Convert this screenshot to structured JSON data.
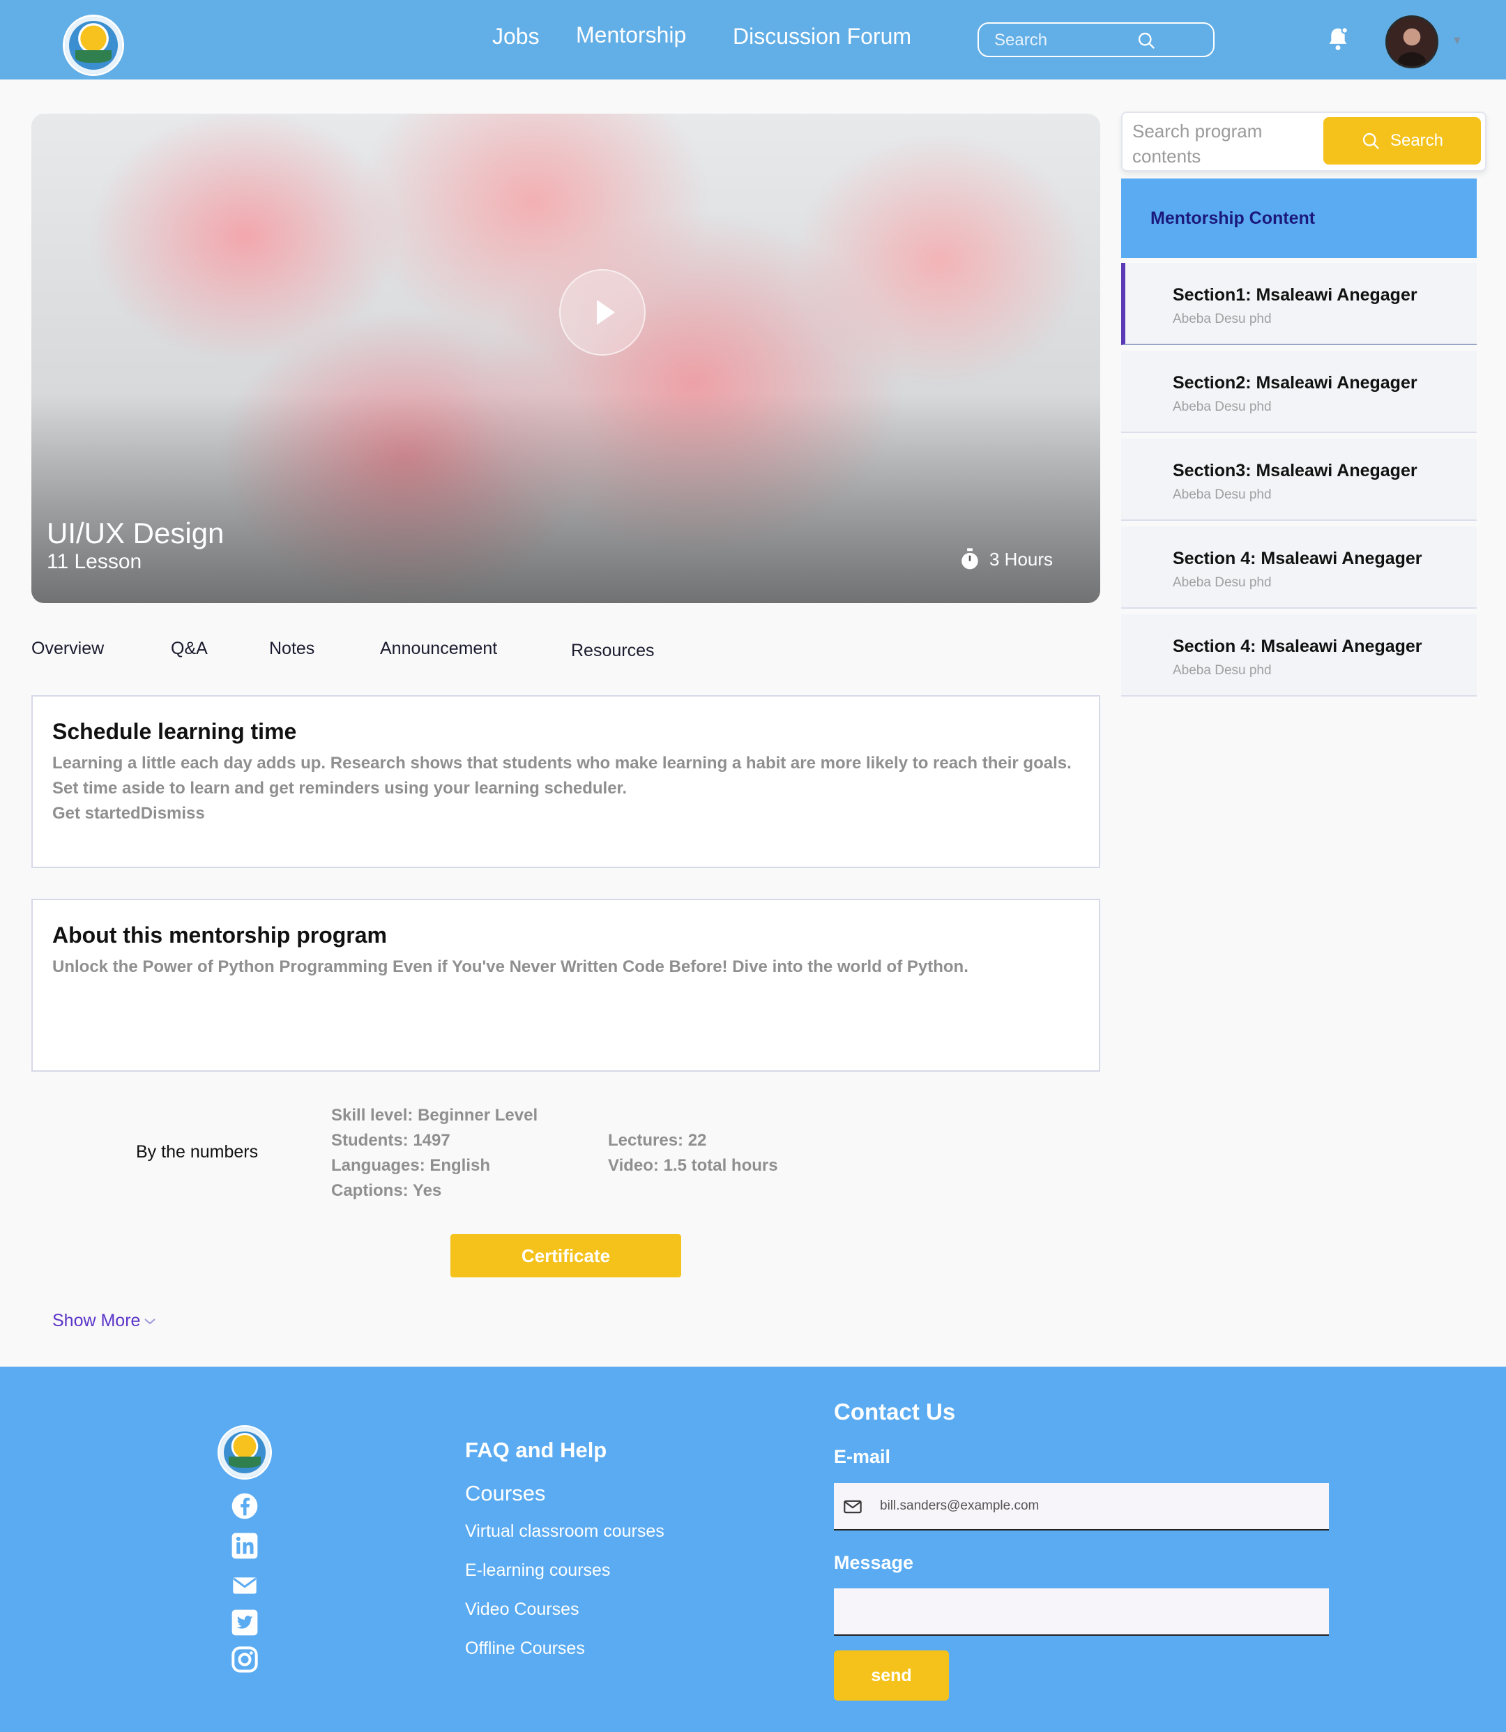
{
  "header": {
    "nav": [
      "Jobs",
      "Mentorship",
      "Discussion Forum"
    ],
    "search_placeholder": "Search"
  },
  "hero": {
    "title": "UI/UX Design",
    "lessons": "11 Lesson",
    "duration": "3 Hours"
  },
  "tabs": [
    "Overview",
    "Q&A",
    "Notes",
    "Announcement",
    "Resources"
  ],
  "schedule": {
    "title": "Schedule learning time",
    "body": "Learning a little each day adds up. Research shows that students who make learning a habit are more likely to reach their goals. Set time aside to learn and get reminders using your learning scheduler.",
    "actions": "Get startedDismiss"
  },
  "about": {
    "title": "About this mentorship program",
    "body": "Unlock the Power of Python Programming Even if You've Never Written Code Before! Dive into the world of Python."
  },
  "numbers": {
    "label": "By the numbers",
    "col1": [
      "Skill level: Beginner Level",
      "Students: 1497",
      "Languages: English",
      "Captions: Yes"
    ],
    "col2": [
      "Lectures: 22",
      "Video: 1.5 total hours"
    ]
  },
  "certificate_label": "Certificate",
  "show_more_label": "Show More",
  "sidebar": {
    "search_placeholder": "Search program contents",
    "search_button": "Search",
    "content_title": "Mentorship Content",
    "sections": [
      {
        "title": "Section1: Msaleawi Anegager",
        "author": "Abeba Desu phd"
      },
      {
        "title": "Section2: Msaleawi Anegager",
        "author": "Abeba Desu phd"
      },
      {
        "title": "Section3: Msaleawi Anegager",
        "author": "Abeba Desu phd"
      },
      {
        "title": "Section 4: Msaleawi Anegager",
        "author": "Abeba Desu phd"
      },
      {
        "title": "Section 4: Msaleawi Anegager",
        "author": "Abeba Desu phd"
      }
    ]
  },
  "footer": {
    "faq_title": "FAQ and Help",
    "courses_title": "Courses",
    "links": [
      "Virtual classroom courses",
      "E-learning courses",
      "Video Courses",
      "Offline Courses"
    ],
    "contact_title": "Contact Us",
    "email_label": "E-mail",
    "email_value": "bill.sanders@example.com",
    "message_label": "Message",
    "send_label": "send"
  },
  "colors": {
    "header_bg": "#62aee6",
    "footer_bg": "#5aabf2",
    "accent_yellow": "#f5c21b",
    "active_section": "#5a3bb5"
  }
}
